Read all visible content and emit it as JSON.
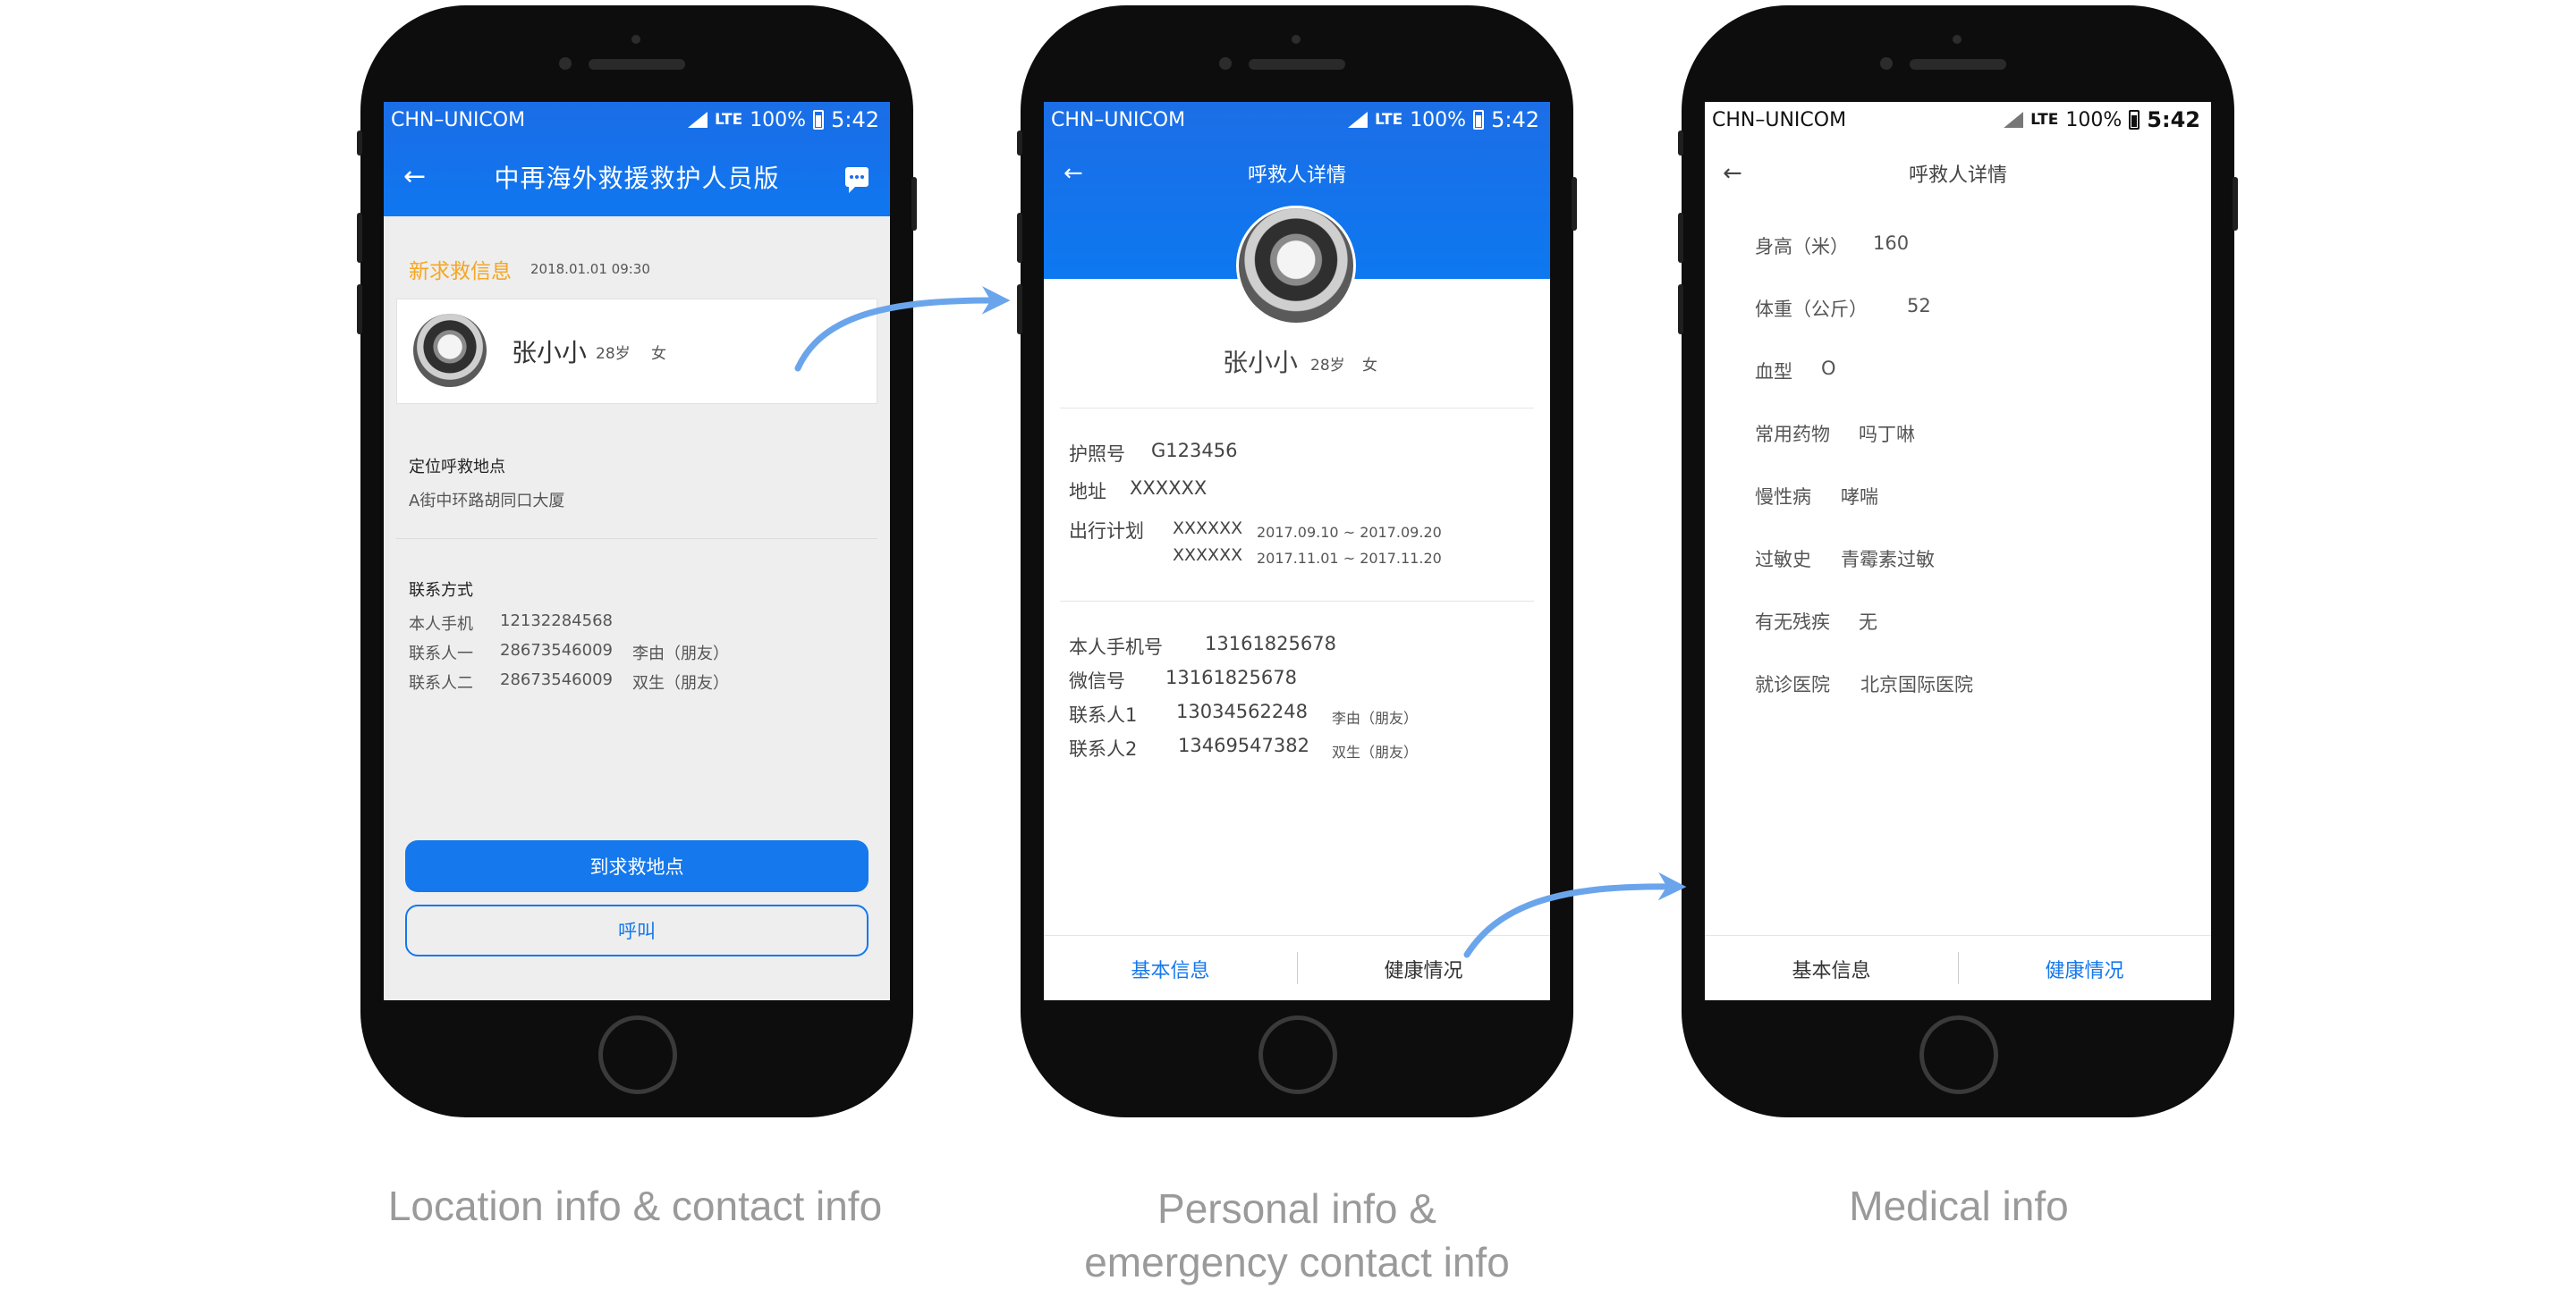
{
  "status_bar": {
    "carrier": "CHN–UNICOM",
    "network": "LTE",
    "battery": "100%",
    "time": "5:42"
  },
  "phone1": {
    "title": "中再海外救援救护人员版",
    "new_title": "新求救信息",
    "new_time": "2018.01.01   09:30",
    "caller_name": "张小小",
    "caller_age": "28岁",
    "caller_gender": "女",
    "location_title": "定位呼救地点",
    "location_text": "A街中环路胡同口大厦",
    "contact_title": "联系方式",
    "contacts": [
      {
        "label": "本人手机",
        "value": "12132284568",
        "note": ""
      },
      {
        "label": "联系人一",
        "value": "28673546009",
        "note": "李由（朋友）"
      },
      {
        "label": "联系人二",
        "value": "28673546009",
        "note": "双生（朋友）"
      }
    ],
    "primary_button": "到求救地点",
    "secondary_button": "呼叫"
  },
  "phone2": {
    "title": "呼救人详情",
    "caller_name": "张小小",
    "caller_age": "28岁",
    "caller_gender": "女",
    "passport_label": "护照号",
    "passport_value": "G123456",
    "address_label": "地址",
    "address_value": "XXXXXX",
    "travel_label": "出行计划",
    "travel": [
      {
        "place": "XXXXXX",
        "dates": "2017.09.10 ~ 2017.09.20"
      },
      {
        "place": "XXXXXX",
        "dates": "2017.11.01 ~ 2017.11.20"
      }
    ],
    "contacts": [
      {
        "label": "本人手机号",
        "value": "13161825678",
        "note": ""
      },
      {
        "label": "微信号",
        "value": "13161825678",
        "note": ""
      },
      {
        "label": "联系人1",
        "value": "13034562248",
        "note": "李由（朋友）"
      },
      {
        "label": "联系人2",
        "value": "13469547382",
        "note": "双生（朋友）"
      }
    ],
    "tab_basic": "基本信息",
    "tab_health": "健康情况"
  },
  "phone3": {
    "title": "呼救人详情",
    "items": [
      {
        "label": "身高（米）",
        "value": "160"
      },
      {
        "label": "体重（公斤）",
        "value": "52"
      },
      {
        "label": "血型",
        "value": "O"
      },
      {
        "label": "常用药物",
        "value": "吗丁啉"
      },
      {
        "label": "慢性病",
        "value": "哮喘"
      },
      {
        "label": "过敏史",
        "value": "青霉素过敏"
      },
      {
        "label": "有无残疾",
        "value": "无"
      },
      {
        "label": "就诊医院",
        "value": "北京国际医院"
      }
    ],
    "tab_basic": "基本信息",
    "tab_health": "健康情况"
  },
  "captions": {
    "c1": "Location info & contact info",
    "c2_line1": "Personal info &",
    "c2_line2": "emergency contact info",
    "c3": "Medical info"
  },
  "colors": {
    "brand_blue": "#1578ec",
    "accent_orange": "#f5a623",
    "arrow_blue": "#6aa5ec"
  },
  "icons": [
    "back-arrow-icon",
    "chat-icon",
    "signal-icon",
    "battery-icon",
    "flow-arrow-icon"
  ]
}
